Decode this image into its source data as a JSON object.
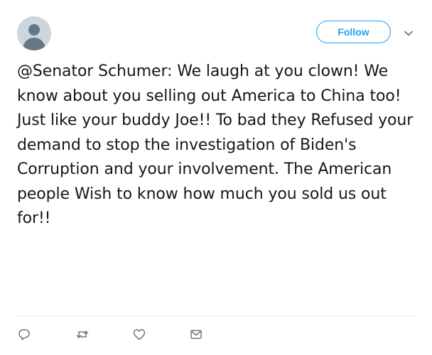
{
  "header": {
    "follow_label": "Follow",
    "caret_icon": "chevron-down-icon",
    "avatar_icon": "default-profile-avatar"
  },
  "tweet": {
    "text": "@Senator Schumer: We laugh at you clown! We know about you selling out America to China too! Just like your buddy Joe!! To bad they Refused your demand to stop the investigation of Biden's Corruption and your involvement. The American people Wish to know how much you sold us out for!!"
  },
  "actions": {
    "icons": [
      "reply-icon",
      "retweet-icon",
      "like-icon",
      "direct-message-icon"
    ]
  },
  "colors": {
    "accent": "#1da1f2",
    "icon_gray": "#657786",
    "text": "#14171a",
    "avatar_bg": "#ccd6dd",
    "divider": "#e6ecf0"
  }
}
